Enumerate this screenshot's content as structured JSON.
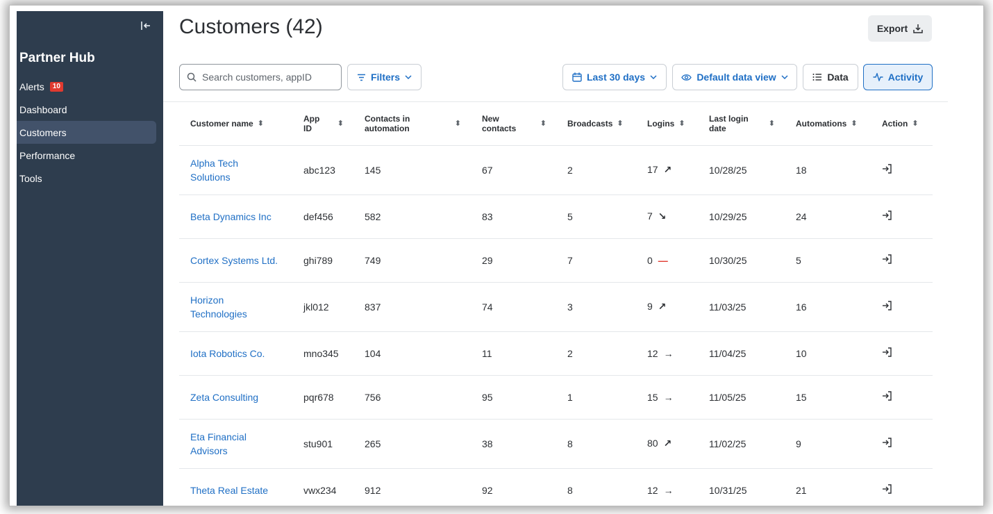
{
  "sidebar": {
    "brand": "Partner Hub",
    "collapse_icon": "collapse-left-icon",
    "items": [
      {
        "label": "Alerts",
        "badge": "10"
      },
      {
        "label": "Dashboard"
      },
      {
        "label": "Customers",
        "active": true
      },
      {
        "label": "Performance"
      },
      {
        "label": "Tools"
      }
    ]
  },
  "header": {
    "title": "Customers (42)",
    "export_label": "Export"
  },
  "toolbar": {
    "search_placeholder": "Search customers, appID",
    "filters_label": "Filters",
    "date_range_label": "Last 30 days",
    "data_view_label": "Default data view",
    "data_label": "Data",
    "activity_label": "Activity"
  },
  "table": {
    "columns": [
      "Customer name",
      "App ID",
      "Contacts in automation",
      "New contacts",
      "Broadcasts",
      "Logins",
      "Last login date",
      "Automations",
      "Action"
    ],
    "rows": [
      {
        "name": "Alpha Tech Solutions",
        "app_id": "abc123",
        "contacts": "145",
        "new_contacts": "67",
        "broadcasts": "2",
        "logins": "17",
        "trend": "↗",
        "last_login": "10/28/25",
        "automations": "18"
      },
      {
        "name": "Beta Dynamics Inc",
        "app_id": "def456",
        "contacts": "582",
        "new_contacts": "83",
        "broadcasts": "5",
        "logins": "7",
        "trend": "↘",
        "last_login": "10/29/25",
        "automations": "24"
      },
      {
        "name": "Cortex Systems Ltd.",
        "app_id": "ghi789",
        "contacts": "749",
        "new_contacts": "29",
        "broadcasts": "7",
        "logins": "0",
        "trend": "—",
        "last_login": "10/30/25",
        "automations": "5"
      },
      {
        "name": "Horizon Technologies",
        "app_id": "jkl012",
        "contacts": "837",
        "new_contacts": "74",
        "broadcasts": "3",
        "logins": "9",
        "trend": "↗",
        "last_login": "11/03/25",
        "automations": "16"
      },
      {
        "name": "Iota Robotics Co.",
        "app_id": "mno345",
        "contacts": "104",
        "new_contacts": "11",
        "broadcasts": "2",
        "logins": "12",
        "trend": "→",
        "last_login": "11/04/25",
        "automations": "10"
      },
      {
        "name": "Zeta Consulting",
        "app_id": "pqr678",
        "contacts": "756",
        "new_contacts": "95",
        "broadcasts": "1",
        "logins": "15",
        "trend": "→",
        "last_login": "11/05/25",
        "automations": "15"
      },
      {
        "name": "Eta Financial Advisors",
        "app_id": "stu901",
        "contacts": "265",
        "new_contacts": "38",
        "broadcasts": "8",
        "logins": "80",
        "trend": "↗",
        "last_login": "11/02/25",
        "automations": "9"
      },
      {
        "name": "Theta Real Estate",
        "app_id": "vwx234",
        "contacts": "912",
        "new_contacts": "92",
        "broadcasts": "8",
        "logins": "12",
        "trend": "→",
        "last_login": "10/31/25",
        "automations": "21"
      }
    ]
  },
  "colors": {
    "sidebar_bg": "#2e3d4e",
    "accent": "#1f6fc5",
    "badge": "#e03a2f"
  }
}
